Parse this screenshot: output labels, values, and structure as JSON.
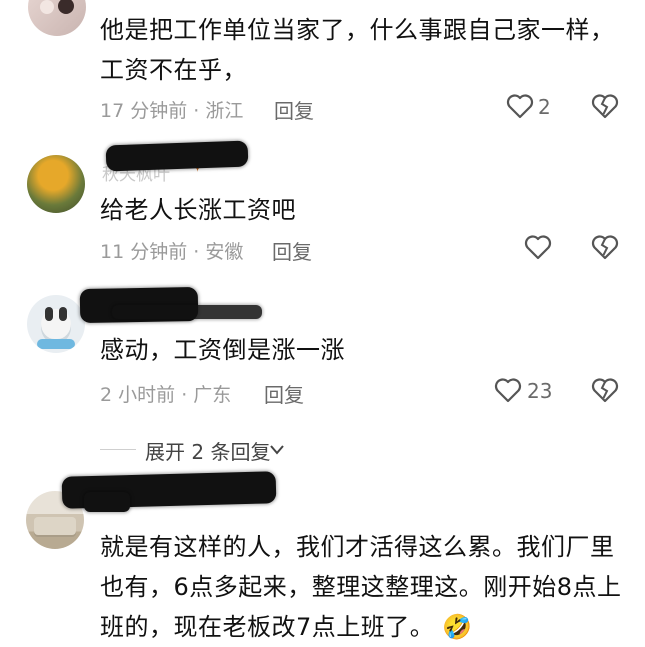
{
  "comments": [
    {
      "text_lines": [
        "他是把工作单位当家了，什么事跟自己家一样，",
        "工资不在乎，"
      ],
      "time": "17 分钟前",
      "location": "浙江",
      "reply_label": "回复",
      "likes": "2"
    },
    {
      "username": "秋天枫叶",
      "text_lines": [
        "给老人长涨工资吧"
      ],
      "time": "11 分钟前",
      "location": "安徽",
      "reply_label": "回复",
      "likes": ""
    },
    {
      "text_lines": [
        "感动，工资倒是涨一涨"
      ],
      "time": "2 小时前",
      "location": "广东",
      "reply_label": "回复",
      "likes": "23"
    },
    {
      "text_lines": [
        "就是有这样的人，我们才活得这么累。我们厂里",
        "也有，6点多起来，整理这整理这。刚开始8点上",
        "班的，现在老板改7点上班了。"
      ],
      "emoji": "🤣"
    }
  ],
  "expand": {
    "label": "展开 2 条回复",
    "icon": "chevron-down-icon"
  },
  "icons": {
    "like": "heart-outline-icon",
    "dislike": "broken-heart-icon",
    "sep": "·"
  }
}
